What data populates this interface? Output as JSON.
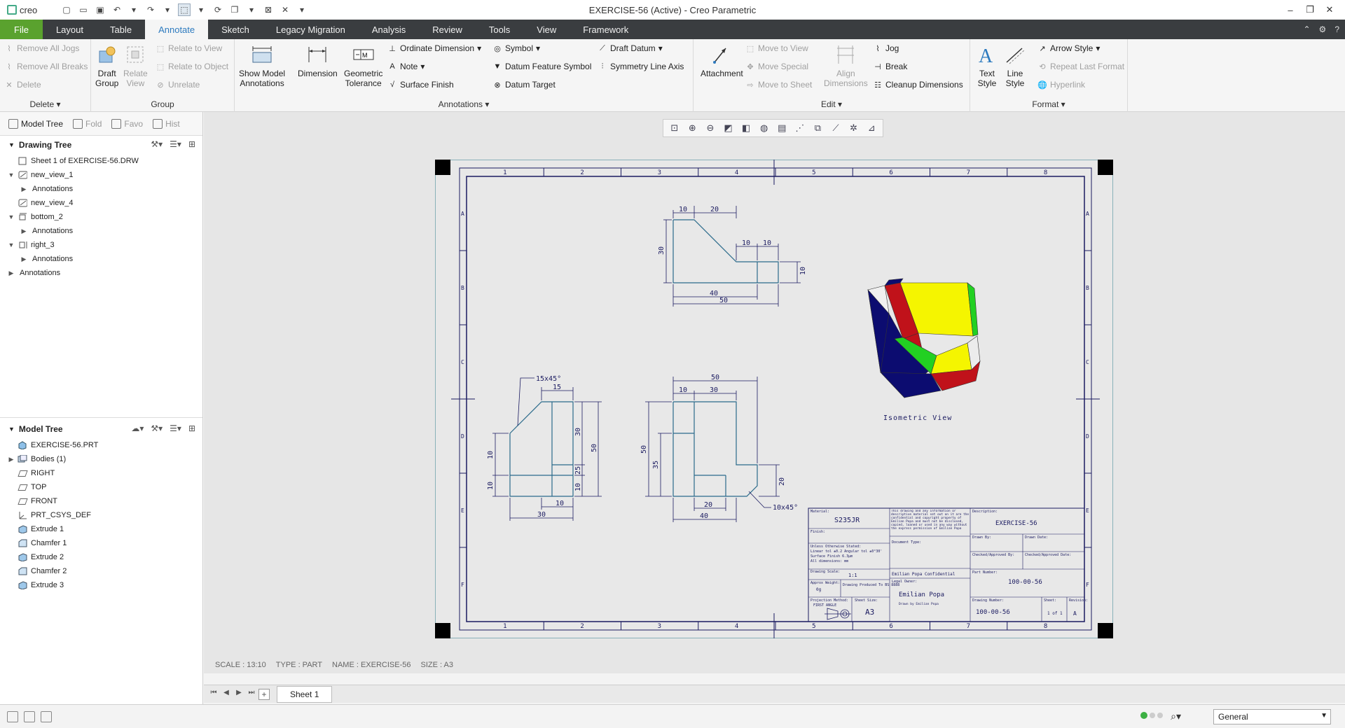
{
  "app": {
    "logo": "creo",
    "title": "EXERCISE-56 (Active) - Creo Parametric",
    "window_controls": [
      "–",
      "❐",
      "✕"
    ]
  },
  "menu_tabs": [
    "File",
    "Layout",
    "Table",
    "Annotate",
    "Sketch",
    "Legacy Migration",
    "Analysis",
    "Review",
    "Tools",
    "View",
    "Framework"
  ],
  "active_tab": "Annotate",
  "ribbon": {
    "delete_group": {
      "label": "Delete",
      "items": [
        "Remove All Jogs",
        "Remove All Breaks",
        "Delete"
      ]
    },
    "group_group": {
      "label": "Group",
      "draft_group": "Draft\nGroup",
      "relate_view": "Relate\nView",
      "items": [
        "Relate to View",
        "Relate to Object",
        "Unrelate"
      ]
    },
    "annotations_group": {
      "label": "Annotations",
      "show_model": "Show Model\nAnnotations",
      "dimension": "Dimension",
      "geometric_tolerance": "Geometric\nTolerance",
      "ordinate_dimension": "Ordinate Dimension",
      "note": "Note",
      "surface_finish": "Surface Finish",
      "symbol": "Symbol",
      "datum_feature_symbol": "Datum Feature Symbol",
      "datum_target": "Datum Target",
      "draft_datum": "Draft Datum",
      "symmetry_line_axis": "Symmetry Line Axis"
    },
    "edit_group": {
      "label": "Edit",
      "attachment": "Attachment",
      "move_to_view": "Move to View",
      "move_special": "Move Special",
      "move_to_sheet": "Move to Sheet",
      "align_dimensions": "Align\nDimensions",
      "jog": "Jog",
      "break": "Break",
      "cleanup_dimensions": "Cleanup Dimensions"
    },
    "format_group": {
      "label": "Format",
      "text_style": "Text\nStyle",
      "line_style": "Line\nStyle",
      "arrow_style": "Arrow Style",
      "repeat_last_format": "Repeat Last Format",
      "hyperlink": "Hyperlink"
    }
  },
  "panel_tabs": [
    "Model Tree",
    "Fold",
    "Favo",
    "Hist"
  ],
  "drawing_tree": {
    "title": "Drawing Tree",
    "nodes": [
      {
        "label": "Sheet 1 of EXERCISE-56.DRW",
        "level": 0
      },
      {
        "label": "new_view_1",
        "level": 1
      },
      {
        "label": "Annotations",
        "level": 2
      },
      {
        "label": "new_view_4",
        "level": 1
      },
      {
        "label": "bottom_2",
        "level": 1
      },
      {
        "label": "Annotations",
        "level": 2
      },
      {
        "label": "right_3",
        "level": 1
      },
      {
        "label": "Annotations",
        "level": 2
      },
      {
        "label": "Annotations",
        "level": 0
      }
    ]
  },
  "model_tree": {
    "title": "Model Tree",
    "nodes": [
      "EXERCISE-56.PRT",
      "Bodies (1)",
      "RIGHT",
      "TOP",
      "FRONT",
      "PRT_CSYS_DEF",
      "Extrude 1",
      "Chamfer 1",
      "Extrude 2",
      "Chamfer 2",
      "Extrude 3"
    ]
  },
  "drawing": {
    "col_labels": [
      "1",
      "2",
      "3",
      "4",
      "5",
      "6",
      "7",
      "8"
    ],
    "row_labels": [
      "A",
      "B",
      "C",
      "D",
      "E",
      "F"
    ],
    "top_view_dims": [
      "10",
      "20",
      "30",
      "10",
      "10",
      "10",
      "40",
      "50"
    ],
    "left_view_dims": [
      "15x45°",
      "15",
      "30",
      "50",
      "25",
      "10",
      "10",
      "10",
      "30",
      "10"
    ],
    "front_view_dims": [
      "50",
      "10",
      "30",
      "50",
      "35",
      "20",
      "20",
      "40",
      "10x45°"
    ],
    "iso_label": "Isometric View",
    "title_block": {
      "material_label": "Material:",
      "material": "S235JR",
      "finish_label": "Finish:",
      "tolerance_lines": [
        "Unless Otherwise Stated:",
        "Linear tol ±0.2  Angular tol ±0°30'",
        "Surface Finish 6.3μm",
        "All dimensions: mm"
      ],
      "drawing_scale_label": "Drawing Scale:",
      "drawing_scale": "1:1",
      "approx_weight_label": "Approx Weight:",
      "weight": "0g",
      "drawing_produced": "Drawing Produced To BS 8888",
      "projection_label": "Projection Method:",
      "projection": "FIRST ANGLE",
      "sheet_size_label": "Sheet Size:",
      "sheet_size": "A3",
      "notice": "This drawing and any information or descriptive material set out on it are the confidential and copyright property of Emilian Popa and must not be disclosed, copied, loaned or used in any way without the express permission of Emilian Popa",
      "security": "Emilian Popa Confidential",
      "document_type_label": "Document Type:",
      "legal_owner_label": "Legal Owner:",
      "owner": "Emilian Popa",
      "owner_note": "Drawn by Emilian Popa",
      "description_label": "Description:",
      "description": "EXERCISE-56",
      "drawn_by_label": "Drawn By:",
      "drawn_date_label": "Drawn Date:",
      "checked_by_label": "Checked/Approved By:",
      "checked_date_label": "Checked/Approved Date:",
      "part_number_label": "Part Number:",
      "part_number": "100-00-56",
      "drawing_number_label": "Drawing Number:",
      "drawing_number": "100-00-56",
      "sheet_label": "Sheet:",
      "sheet": "1 of 1",
      "revision_label": "Revision:",
      "revision": "A"
    }
  },
  "view_status": {
    "scale": "SCALE : 13:10",
    "type": "TYPE : PART",
    "name": "NAME : EXERCISE-56",
    "size": "SIZE : A3"
  },
  "sheet_tab": "Sheet 1",
  "filter": "General",
  "colors": {
    "file_tab": "#5aa22e",
    "tab_bar": "#3a3d40",
    "active_tab_text": "#2e7bbf",
    "sheet_line": "#1a1a60",
    "model_line": "#2a6a8a",
    "iso_yellow": "#f5f500",
    "iso_red": "#c0121a",
    "iso_green": "#22d022",
    "iso_navy": "#0c0c70",
    "iso_white": "#f0f0f0"
  }
}
